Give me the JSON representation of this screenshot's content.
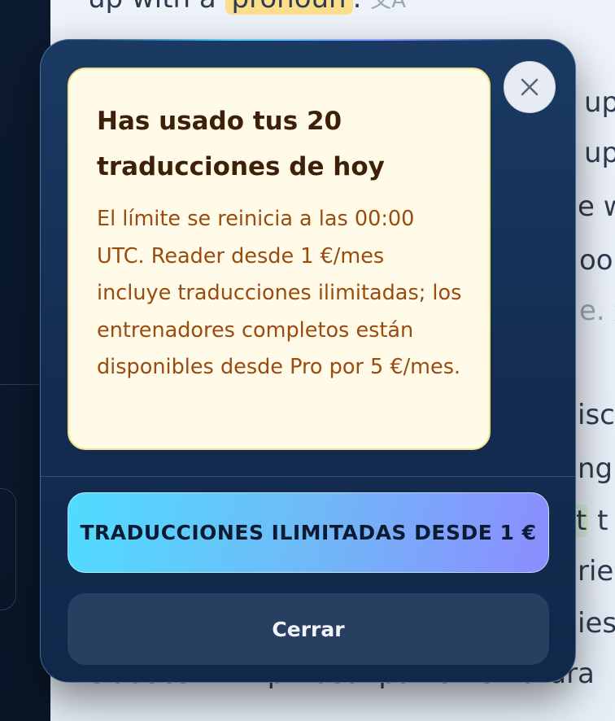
{
  "background": {
    "lines": [
      {
        "pre": "up with a ",
        "highlight": "pronoun",
        "post": ".",
        "icon": "文A"
      },
      {
        "text": "up"
      },
      {
        "text": "up"
      },
      {
        "text": "e w"
      },
      {
        "text": "ook"
      },
      {
        "text": "e.",
        "icon": "文"
      },
      {
        "text": "iscus"
      },
      {
        "text": "ng l"
      },
      {
        "pre": "",
        "highlight": "t",
        "post": " t"
      },
      {
        "text": "rier"
      },
      {
        "text": "ies"
      },
      {
        "text": "clauses with phrasal patterns natura"
      }
    ]
  },
  "modal": {
    "title": "Has usado tus 20 traducciones de hoy",
    "body": "El límite se reinicia a las 00:00 UTC. Reader desde 1 €/mes incluye traducciones ilimitadas; los entrenadores completos están disponibles desde Pro por 5 €/mes.",
    "cta_label": "TRADUCCIONES ILIMITADAS DESDE 1 €",
    "close_label": "Cerrar"
  },
  "colors": {
    "modal_bg": "#132c50",
    "notice_bg": "#fffbe8",
    "notice_title": "#3e1f08",
    "notice_body": "#9a4b10",
    "cta_start": "#4fdcff",
    "cta_end": "#8b8cff"
  }
}
